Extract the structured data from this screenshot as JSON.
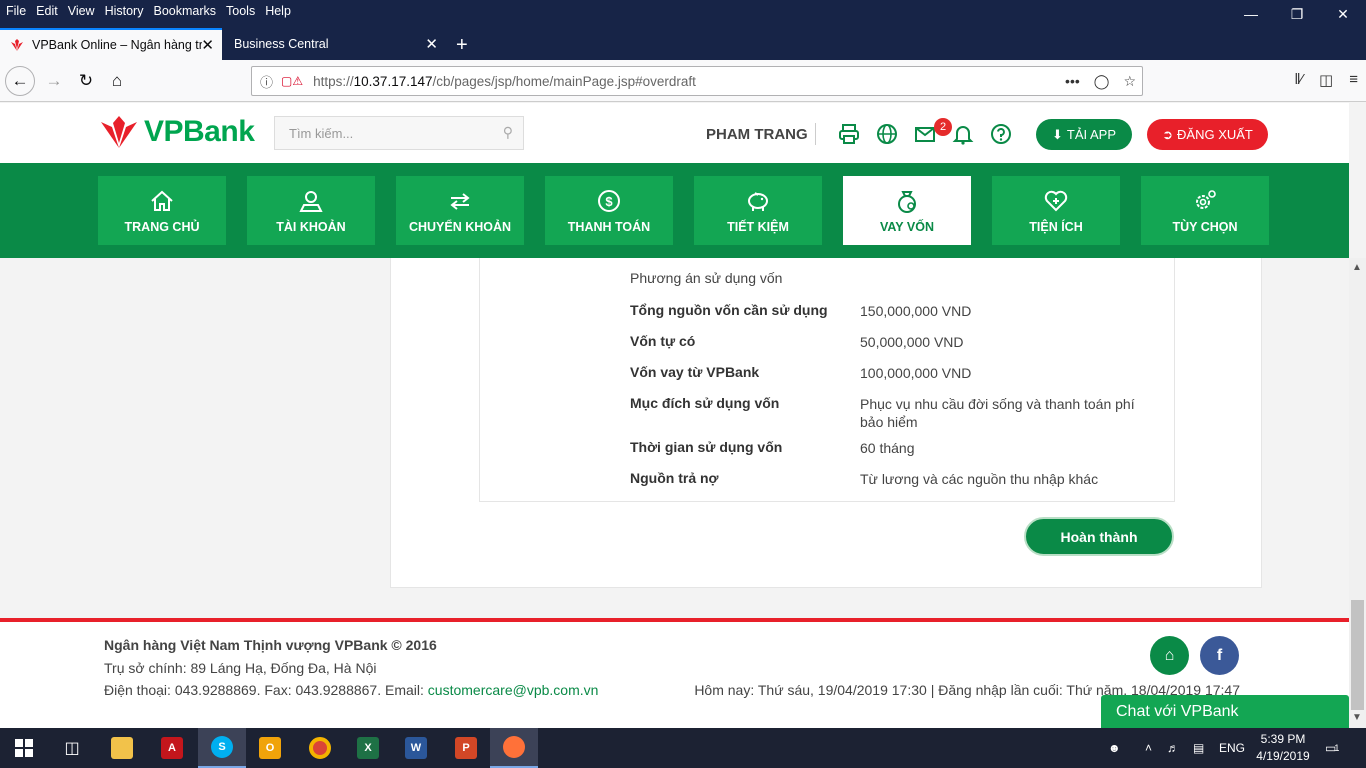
{
  "browser": {
    "menu": [
      "File",
      "Edit",
      "View",
      "History",
      "Bookmarks",
      "Tools",
      "Help"
    ],
    "tabs": [
      {
        "title": "VPBank Online – Ngân hàng trự",
        "active": true
      },
      {
        "title": "Business Central",
        "active": false
      }
    ],
    "url_prefix": "https://",
    "url_host": "10.37.17.147",
    "url_path": "/cb/pages/jsp/home/mainPage.jsp#overdraft"
  },
  "header": {
    "logo_text": "VPBank",
    "search_placeholder": "Tìm kiếm...",
    "username": "PHAM TRANG",
    "mail_badge": "2",
    "app_button": "TẢI APP",
    "logout_button": "ĐĂNG XUẤT"
  },
  "nav": [
    {
      "label": "TRANG CHỦ",
      "icon": "home-icon"
    },
    {
      "label": "TÀI KHOẢN",
      "icon": "user-icon"
    },
    {
      "label": "CHUYỂN KHOẢN",
      "icon": "transfer-icon"
    },
    {
      "label": "THANH TOÁN",
      "icon": "dollar-icon"
    },
    {
      "label": "TIẾT KIỆM",
      "icon": "piggy-bank-icon"
    },
    {
      "label": "VAY VỐN",
      "icon": "money-bag-icon",
      "active": true
    },
    {
      "label": "TIỆN ÍCH",
      "icon": "heart-icon"
    },
    {
      "label": "TÙY CHỌN",
      "icon": "gear-icon"
    }
  ],
  "loan": {
    "section_title": "Phương án sử dụng vốn",
    "rows": [
      {
        "label": "Tổng nguồn vốn cần sử dụng",
        "value": "150,000,000 VND"
      },
      {
        "label": "Vốn tự có",
        "value": "50,000,000 VND"
      },
      {
        "label": "Vốn vay từ VPBank",
        "value": "100,000,000 VND"
      },
      {
        "label": "Mục đích sử dụng vốn",
        "value": "Phục vụ nhu cầu đời sống và thanh toán phí bảo hiểm"
      },
      {
        "label": "Thời gian sử dụng vốn",
        "value": "60 tháng"
      },
      {
        "label": "Nguồn trả nợ",
        "value": "Từ lương và các nguồn thu nhập khác"
      }
    ],
    "done_button": "Hoàn thành"
  },
  "footer": {
    "bank_name": "Ngân hàng Việt Nam Thịnh vượng VPBank © 2016",
    "address": "Trụ sở chính: 89 Láng Hạ, Đống Đa, Hà Nội",
    "contact_prefix": "Điện thoại: 043.9288869. Fax: 043.9288867. Email: ",
    "email": "customercare@vpb.com.vn",
    "session": "Hôm nay: Thứ sáu, 19/04/2019 17:30 | Đăng nhập lần cuối: Thứ năm, 18/04/2019 17:47",
    "chat": "Chat với VPBank"
  },
  "taskbar": {
    "language": "ENG",
    "time": "5:39 PM",
    "date": "4/19/2019",
    "notifications": "1"
  },
  "colors": {
    "brand_green": "#0a8a47",
    "tile_green": "#13a653",
    "brand_red": "#e8202a"
  }
}
